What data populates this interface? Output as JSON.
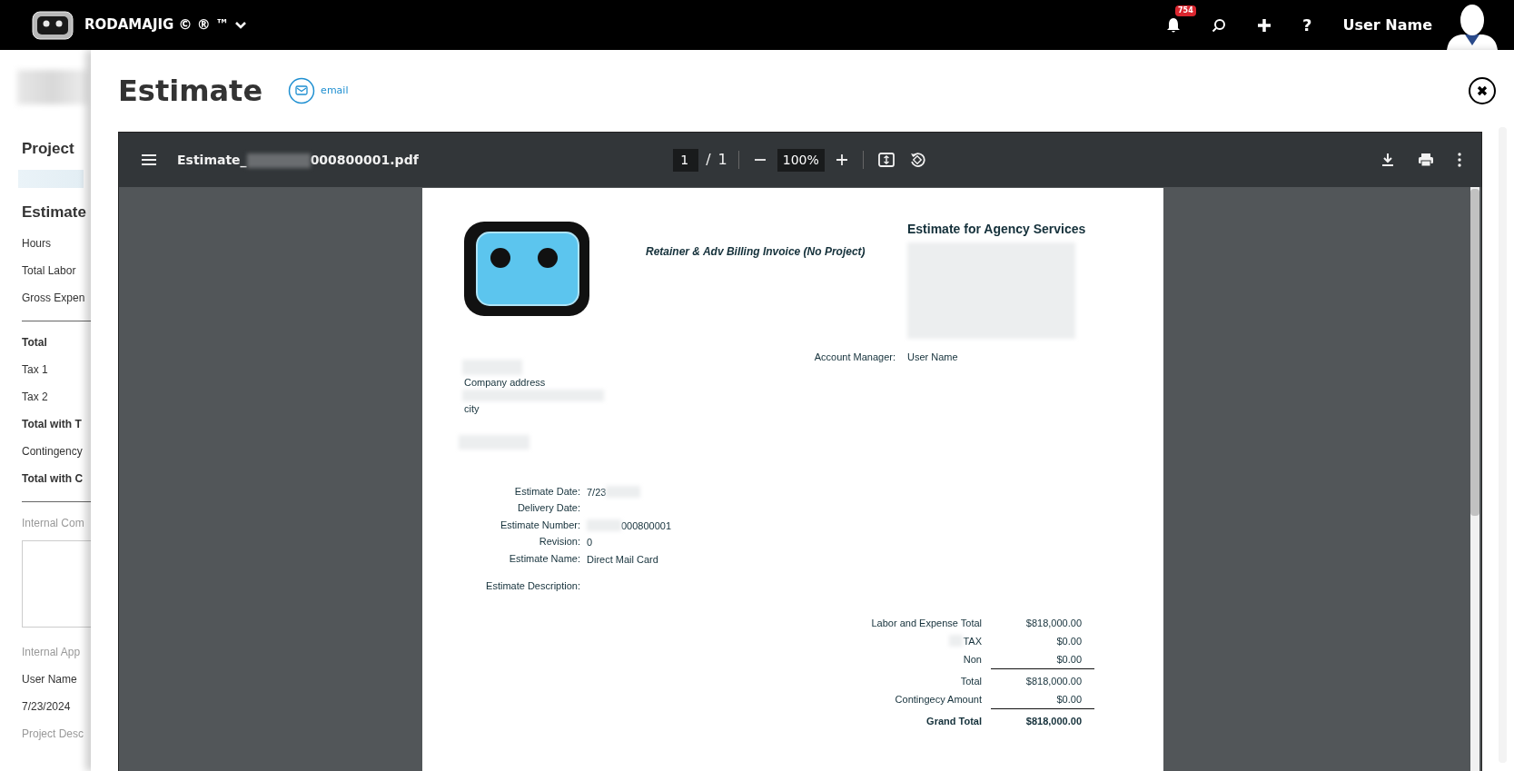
{
  "app_bar": {
    "brand": "RODAMAJIG © ® ™",
    "notification_count": "754",
    "help": "?",
    "user_name": "User Name"
  },
  "background_page": {
    "items": [
      {
        "kind": "redacted"
      },
      {
        "kind": "heading",
        "text": "Project"
      },
      {
        "kind": "redacted_link"
      },
      {
        "kind": "heading",
        "text": "Estimate"
      },
      {
        "kind": "row",
        "text": "Hours"
      },
      {
        "kind": "row",
        "text": "Total Labor"
      },
      {
        "kind": "row",
        "text": "Gross Expen"
      },
      {
        "kind": "divider"
      },
      {
        "kind": "total",
        "text": "Total"
      },
      {
        "kind": "row",
        "text": "Tax 1"
      },
      {
        "kind": "row",
        "text": "Tax 2"
      },
      {
        "kind": "total",
        "text": "Total with T"
      },
      {
        "kind": "row",
        "text": "Contingency"
      },
      {
        "kind": "total",
        "text": "Total with C"
      },
      {
        "kind": "divider"
      },
      {
        "kind": "muted",
        "text": "Internal Com"
      },
      {
        "kind": "textarea"
      },
      {
        "kind": "muted",
        "text": "Internal App"
      },
      {
        "kind": "row",
        "text": "User Name"
      },
      {
        "kind": "row",
        "text": "7/23/2024"
      },
      {
        "kind": "muted",
        "text": "Project Desc"
      }
    ]
  },
  "modal": {
    "title": "Estimate",
    "email_label": "email"
  },
  "pdf_viewer": {
    "file_name_start": "Estimate_",
    "file_name_end": "000800001.pdf",
    "page": "1",
    "page_separator": "/",
    "page_count": "1",
    "zoom": "100%"
  },
  "document": {
    "subtitle": "Retainer & Adv Billing Invoice (No Project)",
    "heading": "Estimate for Agency Services",
    "account_manager_label": "Account Manager:",
    "account_manager": "User Name",
    "address": [
      "Company address",
      "city"
    ],
    "fields": [
      {
        "label": "Estimate Date:",
        "parts": [
          {
            "kind": "text",
            "text": "7/23"
          },
          {
            "kind": "redacted"
          }
        ]
      },
      {
        "label": "Delivery Date:"
      },
      {
        "label": "Estimate Number:",
        "parts": [
          {
            "kind": "redacted"
          },
          {
            "kind": "text",
            "text": "000800001"
          }
        ]
      },
      {
        "label": "Revision:",
        "parts": [
          {
            "kind": "text",
            "text": "0"
          }
        ]
      },
      {
        "label": "Estimate Name:",
        "parts": [
          {
            "kind": "text",
            "text": "Direct Mail Card"
          }
        ]
      }
    ],
    "description_label": "Estimate Description:",
    "totals": [
      {
        "label_parts": [
          {
            "kind": "text",
            "text": "Labor and Expense Total"
          }
        ],
        "amount": "$818,000.00",
        "rule_below": false,
        "bold": false
      },
      {
        "label_parts": [
          {
            "kind": "redacted"
          },
          {
            "kind": "text",
            "text": "TAX"
          }
        ],
        "amount": "$0.00",
        "rule_below": false,
        "bold": false
      },
      {
        "label_parts": [
          {
            "kind": "text",
            "text": "Non"
          }
        ],
        "amount": "$0.00",
        "rule_below": true,
        "bold": false
      },
      {
        "label_parts": [
          {
            "kind": "text",
            "text": "Total"
          }
        ],
        "amount": "$818,000.00",
        "rule_below": false,
        "bold": false
      },
      {
        "label_parts": [
          {
            "kind": "text",
            "text": "Contingecy Amount"
          }
        ],
        "amount": "$0.00",
        "rule_below": true,
        "bold": false
      },
      {
        "label_parts": [
          {
            "kind": "text",
            "text": "Grand Total"
          }
        ],
        "amount": "$818,000.00",
        "rule_below": false,
        "bold": true
      }
    ]
  }
}
